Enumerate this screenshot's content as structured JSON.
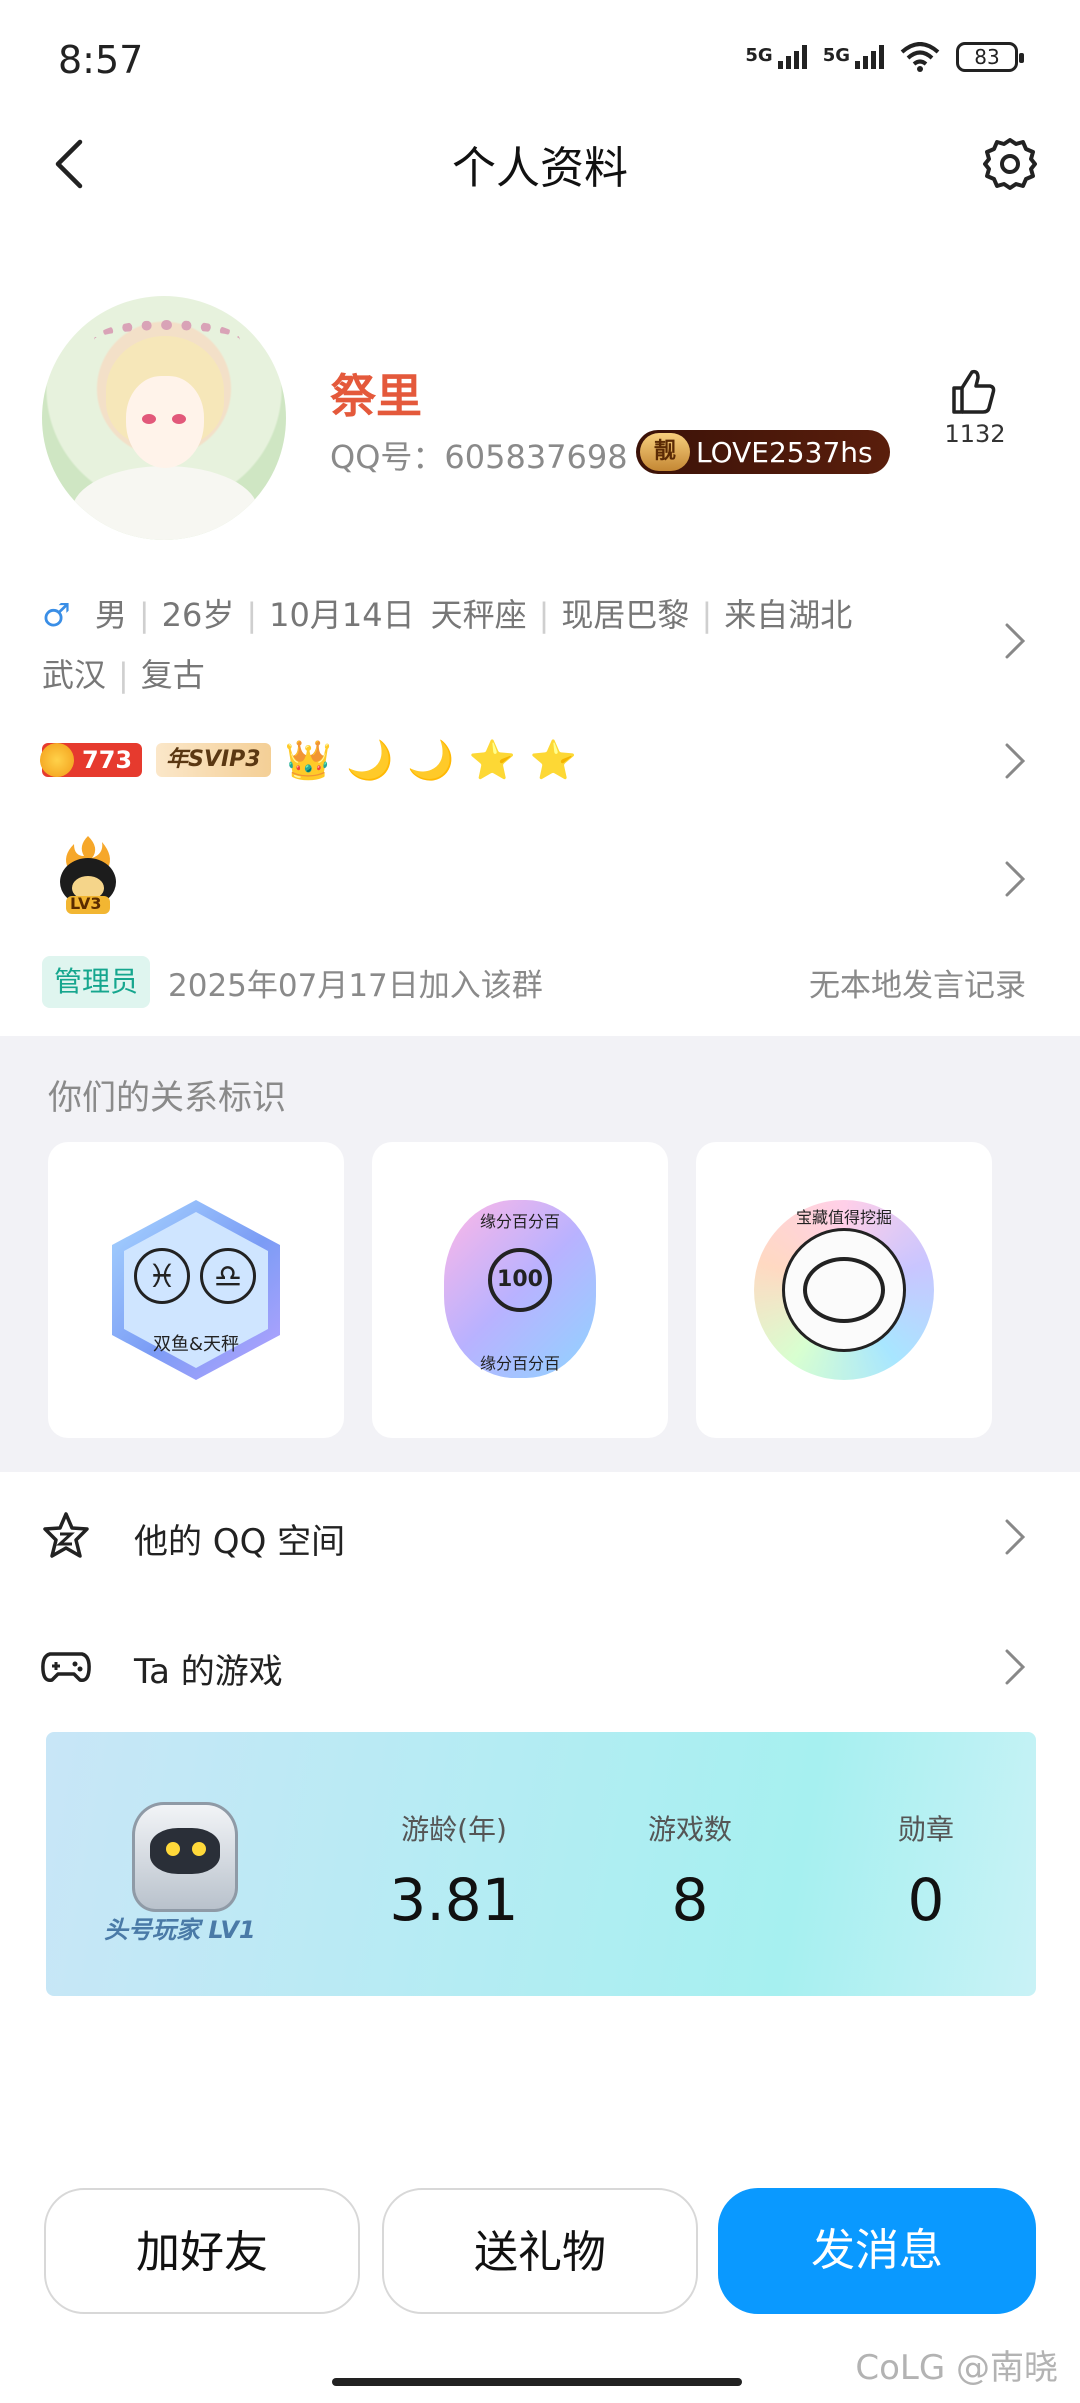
{
  "status_bar": {
    "time": "8:57",
    "net1": "5G",
    "net2": "5G",
    "battery": "83"
  },
  "header": {
    "title": "个人资料"
  },
  "profile": {
    "nickname": "祭里",
    "qq_label": "QQ号：605837698",
    "level_badge_icon_text": "靓",
    "level_badge_text": "LOVE2537hs",
    "like_count": "1132"
  },
  "info": {
    "gender_symbol": "♂",
    "gender": "男",
    "age": "26岁",
    "birthday": "10月14日",
    "constellation": "天秤座",
    "location": "现居巴黎",
    "hometown_a": "来自湖北",
    "hometown_b": "武汉",
    "tag": "复古"
  },
  "badges": {
    "grade_number": "773",
    "svip": "年SVIP3",
    "level_icons": [
      "👑",
      "🌙",
      "🌙",
      "⭐",
      "⭐"
    ]
  },
  "group": {
    "lv_badge": "LV3",
    "admin_tag": "管理员",
    "join_text": "2025年07月17日加入该群",
    "no_record": "无本地发言记录"
  },
  "relationship": {
    "title": "你们的关系标识",
    "card1_text": "双鱼&天秤",
    "card1_sign_a": "♓",
    "card1_sign_b": "♎",
    "card2_text_top": "缘分百分百",
    "card2_text_bottom": "缘分百分百",
    "card2_heart": "100",
    "card3_text": "宝藏值得挖掘"
  },
  "rows": {
    "qzone": "他的 QQ 空间",
    "games": "Ta 的游戏"
  },
  "game_card": {
    "player_label": "头号玩家 LV1",
    "stats": [
      {
        "label": "游龄(年)",
        "value": "3.81"
      },
      {
        "label": "游戏数",
        "value": "8"
      },
      {
        "label": "勋章",
        "value": "0"
      }
    ]
  },
  "buttons": {
    "add_friend": "加好友",
    "send_gift": "送礼物",
    "send_message": "发消息"
  },
  "watermark": "CoLG @南晓",
  "colors": {
    "accent": "#0a99ff",
    "nickname": "#e4593b"
  }
}
